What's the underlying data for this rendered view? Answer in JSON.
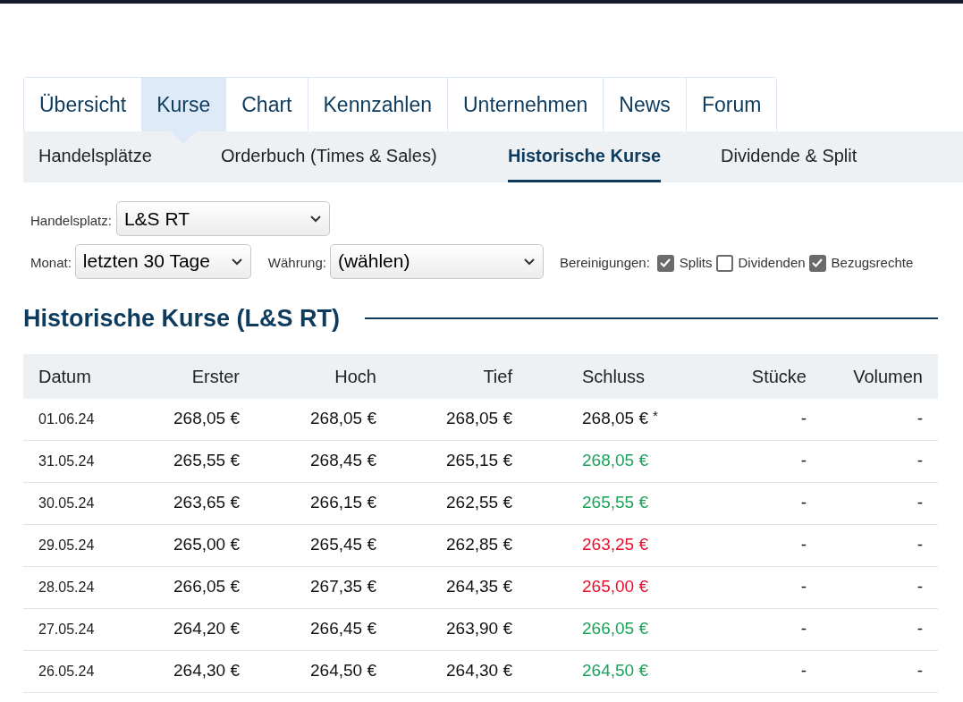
{
  "tabs": [
    {
      "label": "Übersicht",
      "selected": false
    },
    {
      "label": "Kurse",
      "selected": true
    },
    {
      "label": "Chart",
      "selected": false
    },
    {
      "label": "Kennzahlen",
      "selected": false
    },
    {
      "label": "Unternehmen",
      "selected": false
    },
    {
      "label": "News",
      "selected": false
    },
    {
      "label": "Forum",
      "selected": false
    }
  ],
  "subtabs": [
    {
      "label": "Handelsplätze",
      "selected": false
    },
    {
      "label": "Orderbuch (Times & Sales)",
      "selected": false
    },
    {
      "label": "Historische Kurse",
      "selected": true
    },
    {
      "label": "Dividende & Split",
      "selected": false
    }
  ],
  "filters": {
    "handelsplatz": {
      "label": "Handelsplatz:",
      "value": "L&S RT"
    },
    "monat": {
      "label": "Monat:",
      "value": "letzten 30 Tage"
    },
    "waehrung": {
      "label": "Währung:",
      "value": "(wählen)"
    },
    "bereinigungen": {
      "label": "Bereinigungen:",
      "options": [
        {
          "label": "Splits",
          "checked": true
        },
        {
          "label": "Dividenden",
          "checked": false
        },
        {
          "label": "Bezugsrechte",
          "checked": true
        }
      ]
    }
  },
  "heading": "Historische Kurse (L&S RT)",
  "table": {
    "columns": [
      "Datum",
      "Erster",
      "Hoch",
      "Tief",
      "Schluss",
      "Stücke",
      "Volumen"
    ],
    "rows": [
      {
        "datum": "01.06.24",
        "erster": "268,05 €",
        "hoch": "268,05 €",
        "tief": "268,05 €",
        "schluss": "268,05 €",
        "color": "#111111",
        "note": "*",
        "stuecke": "-",
        "volumen": "-"
      },
      {
        "datum": "31.05.24",
        "erster": "265,55 €",
        "hoch": "268,45 €",
        "tief": "265,15 €",
        "schluss": "268,05 €",
        "color": "#1aa35a",
        "stuecke": "-",
        "volumen": "-"
      },
      {
        "datum": "30.05.24",
        "erster": "263,65 €",
        "hoch": "266,15 €",
        "tief": "262,55 €",
        "schluss": "265,55 €",
        "color": "#1aa35a",
        "stuecke": "-",
        "volumen": "-"
      },
      {
        "datum": "29.05.24",
        "erster": "265,00 €",
        "hoch": "265,45 €",
        "tief": "262,85 €",
        "schluss": "263,25 €",
        "color": "#e8102e",
        "stuecke": "-",
        "volumen": "-"
      },
      {
        "datum": "28.05.24",
        "erster": "266,05 €",
        "hoch": "267,35 €",
        "tief": "264,35 €",
        "schluss": "265,00 €",
        "color": "#e8102e",
        "stuecke": "-",
        "volumen": "-"
      },
      {
        "datum": "27.05.24",
        "erster": "264,20 €",
        "hoch": "266,45 €",
        "tief": "263,90 €",
        "schluss": "266,05 €",
        "color": "#1aa35a",
        "stuecke": "-",
        "volumen": "-"
      },
      {
        "datum": "26.05.24",
        "erster": "264,30 €",
        "hoch": "264,50 €",
        "tief": "264,30 €",
        "schluss": "264,50 €",
        "color": "#1aa35a",
        "stuecke": "-",
        "volumen": "-"
      }
    ]
  }
}
